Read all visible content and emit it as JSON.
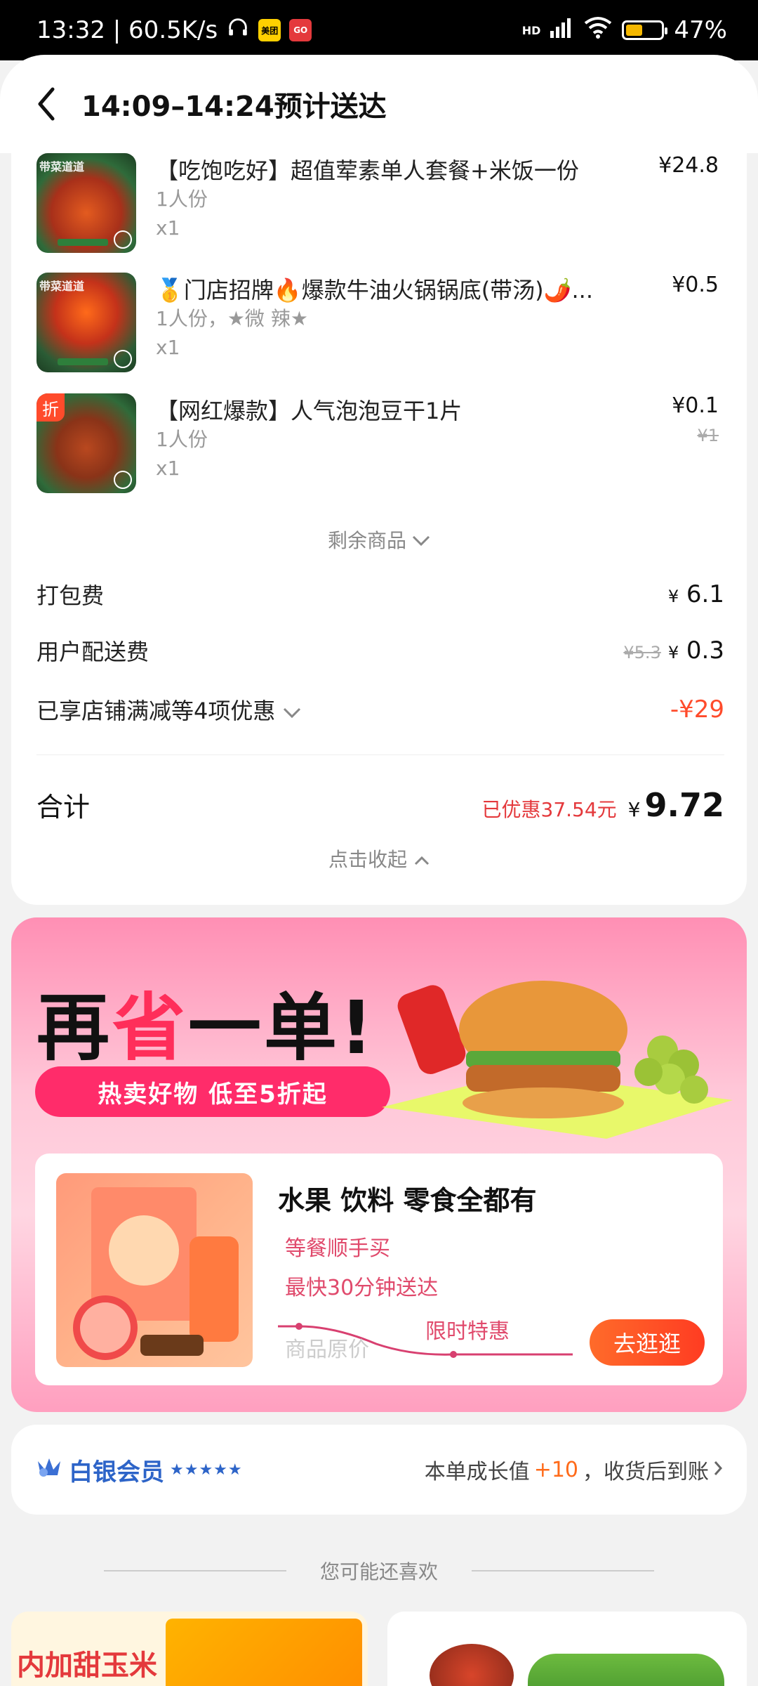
{
  "status_bar": {
    "time_speed": "13:32 | 60.5K/s",
    "badge1": "美团",
    "badge2": "GO",
    "network": "HD",
    "battery": "47%"
  },
  "header": {
    "title": "14:09–14:24预计送达"
  },
  "items": [
    {
      "name": "【吃饱吃好】超值荤素单人套餐+米饭一份",
      "spec": "1人份",
      "qty": "x1",
      "price": "¥24.8",
      "orig": "",
      "thumb_tag": "带菜道道"
    },
    {
      "name": "🥇门店招牌🔥爆款牛油火锅锅底(带汤)🌶️...",
      "spec": "1人份，★微 辣★",
      "qty": "x1",
      "price": "¥0.5",
      "orig": "",
      "thumb_tag": "带菜道道"
    },
    {
      "name": "【网红爆款】人气泡泡豆干1片",
      "spec": "1人份",
      "qty": "x1",
      "price": "¥0.1",
      "orig": "¥1",
      "thumb_tag": "折"
    }
  ],
  "more_label": "剩余商品",
  "fees": {
    "packing_label": "打包费",
    "packing_value": "6.1",
    "delivery_label": "用户配送费",
    "delivery_orig": "¥5.3",
    "delivery_value": "0.3",
    "discount_label": "已享店铺满减等4项优惠",
    "discount_value": "-¥29"
  },
  "total": {
    "label": "合计",
    "saved": "已优惠37.54元",
    "amount": "9.72"
  },
  "collapse_label": "点击收起",
  "promo": {
    "title_pre": "再",
    "title_hl": "省",
    "title_post": "一单!",
    "pill": "热卖好物 低至5折起",
    "heading": "水果 饮料 零食全都有",
    "sub1": "等餐顺手买",
    "sub2": "最快30分钟送达",
    "orig_label": "商品原价",
    "deal_label": "限时特惠",
    "go_button": "去逛逛"
  },
  "member": {
    "name": "白银会员",
    "stars": "★★★★★",
    "growth_prefix": "本单成长值",
    "growth_value": "+10",
    "growth_suffix": "，收货后到账"
  },
  "reco": {
    "label": "您可能还喜欢",
    "card1_text": "内加甜玉米"
  }
}
